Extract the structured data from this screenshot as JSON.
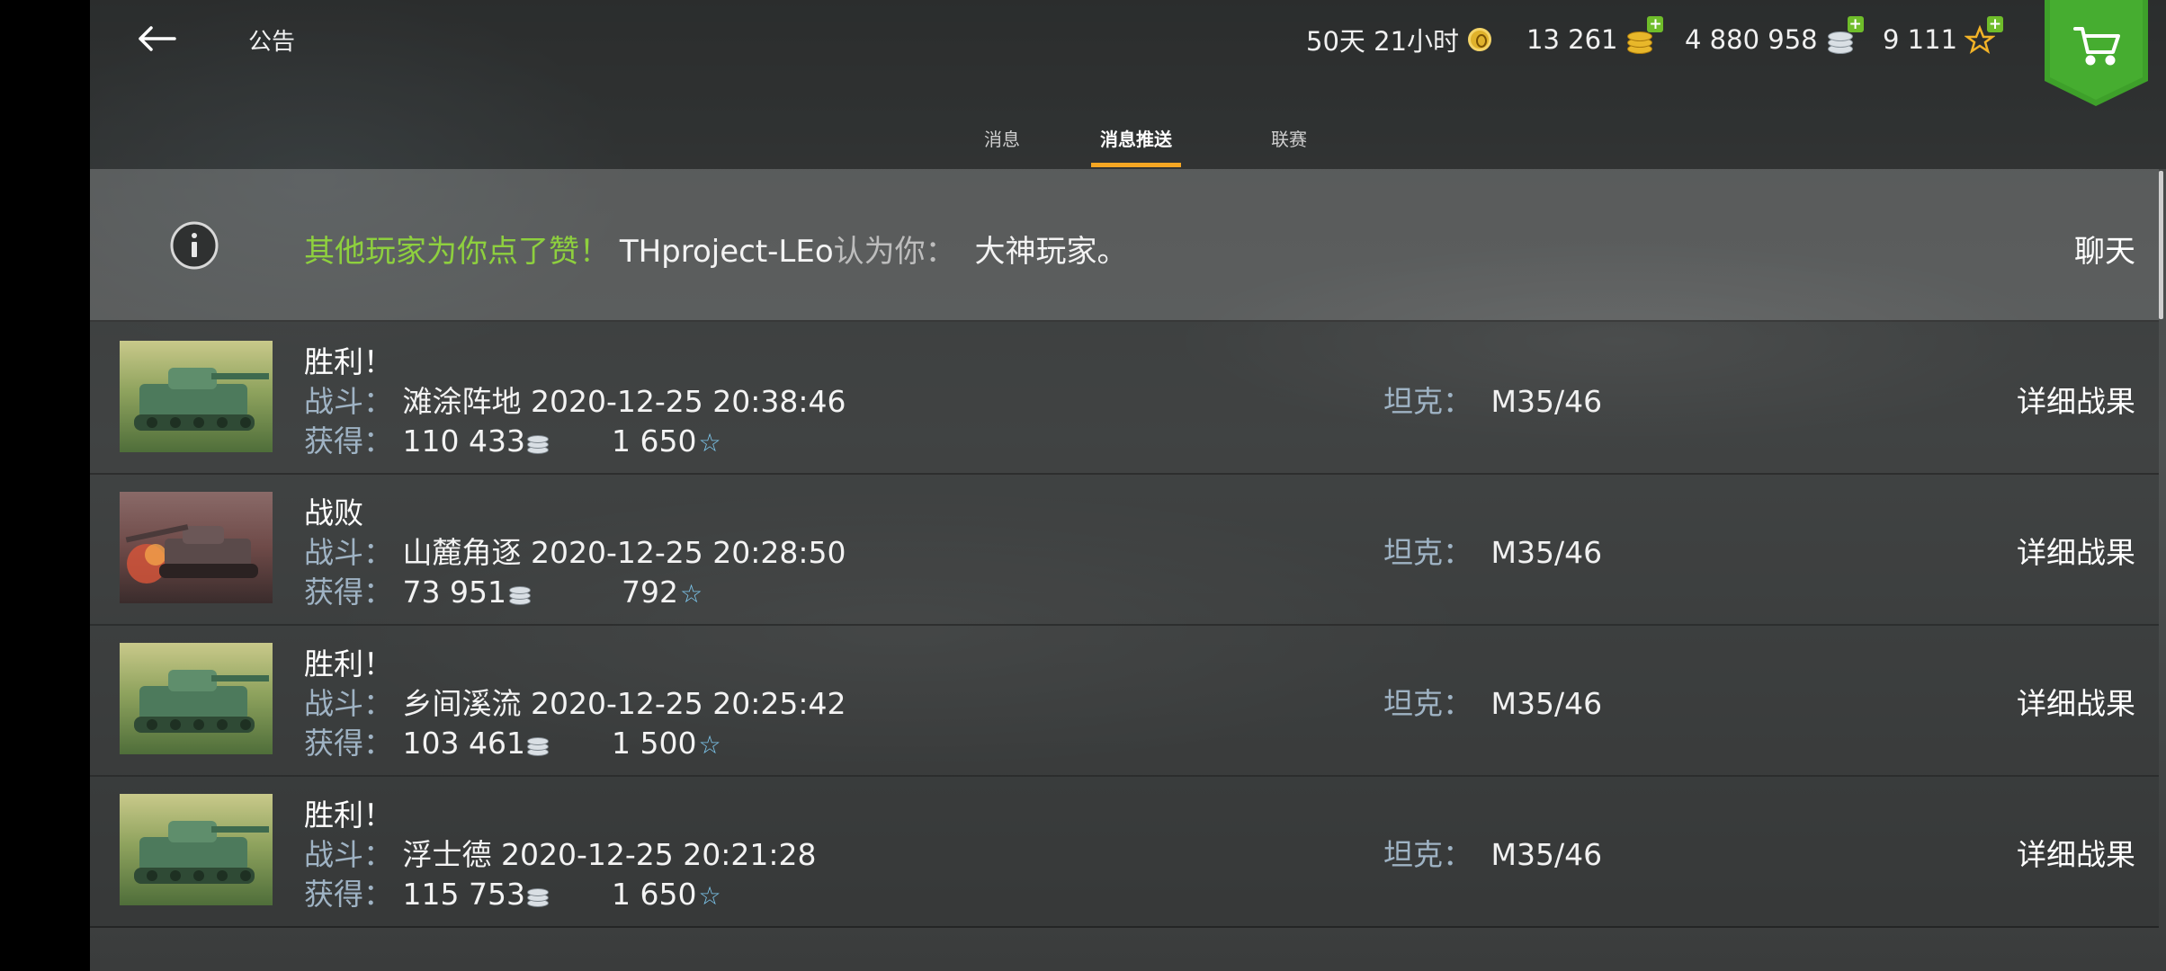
{
  "header": {
    "back_label": "",
    "title": "公告",
    "premium_time": "50天 21小时",
    "gold": "13 261",
    "silver": "4 880 958",
    "free_xp": "9 111",
    "icons": {
      "back": "back-arrow-icon",
      "premium": "premium-badge-icon",
      "gold": "gold-coin-icon",
      "silver": "silver-coin-icon",
      "free_xp": "star-icon",
      "shop": "cart-icon"
    },
    "colors": {
      "accent": "#f5a623",
      "positive": "#8ed03e",
      "plus": "#6fbd2a",
      "shop": "#3ea02a"
    }
  },
  "tabs": [
    {
      "label": "消息",
      "active": false
    },
    {
      "label": "消息推送",
      "active": true
    },
    {
      "label": "联赛",
      "active": false
    }
  ],
  "notice": {
    "highlight": "其他玩家为你点了赞！",
    "player": "THproject-LEo",
    "says": "认为你：",
    "compliment": "大神玩家。",
    "action": "聊天"
  },
  "battle_labels": {
    "battle": "战斗：",
    "earned": "获得：",
    "tank": "坦克：",
    "details": "详细战果"
  },
  "battles": [
    {
      "result": "胜利！",
      "map": "滩涂阵地",
      "datetime": "2020-12-25 20:38:46",
      "silver": "110 433",
      "xp": "1 650",
      "tank": "M35/46",
      "thumbnail": "victory"
    },
    {
      "result": "战败",
      "map": "山麓角逐",
      "datetime": "2020-12-25 20:28:50",
      "silver": "73 951",
      "xp": "792",
      "tank": "M35/46",
      "thumbnail": "defeat"
    },
    {
      "result": "胜利！",
      "map": "乡间溪流",
      "datetime": "2020-12-25 20:25:42",
      "silver": "103 461",
      "xp": "1 500",
      "tank": "M35/46",
      "thumbnail": "victory"
    },
    {
      "result": "胜利！",
      "map": "浮士德",
      "datetime": "2020-12-25 20:21:28",
      "silver": "115 753",
      "xp": "1 650",
      "tank": "M35/46",
      "thumbnail": "victory"
    }
  ]
}
